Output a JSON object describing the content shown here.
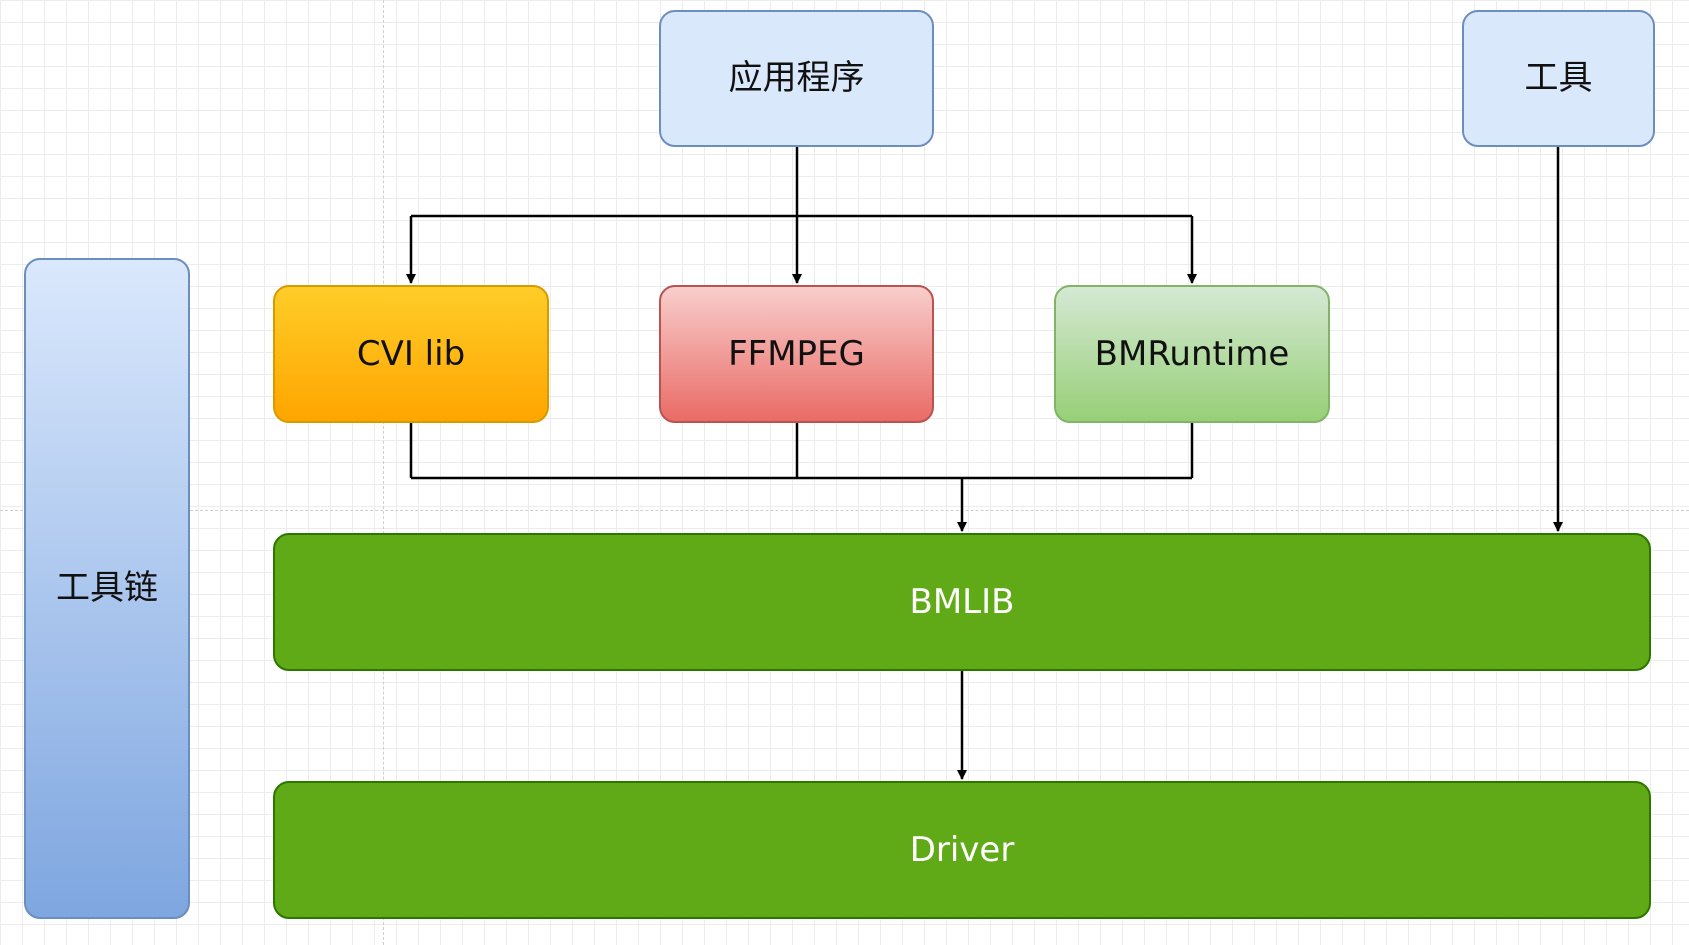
{
  "nodes": {
    "app": {
      "label": "应用程序"
    },
    "tools": {
      "label": "工具"
    },
    "toolchain": {
      "label": "工具链"
    },
    "cvi_lib": {
      "label": "CVI lib"
    },
    "ffmpeg": {
      "label": "FFMPEG"
    },
    "bmruntime": {
      "label": "BMRuntime"
    },
    "bmlib": {
      "label": "BMLIB"
    },
    "driver": {
      "label": "Driver"
    }
  },
  "colors": {
    "app_fill": "#dae8fc",
    "app_stroke": "#6c8ebf",
    "cvi_fill_top": "#ffcd28",
    "cvi_fill_bottom": "#ffa500",
    "ffmpeg_fill_top": "#f8cecc",
    "ffmpeg_fill_bottom": "#ea6b66",
    "bmruntime_fill_top": "#d5e8d4",
    "bmruntime_fill_bottom": "#97d077",
    "bmlib_fill": "#60a917",
    "driver_fill": "#60a917",
    "toolchain_fill_top": "#dae8fc",
    "toolchain_fill_bottom": "#7ea6e0",
    "connector": "#000000"
  },
  "edges": [
    {
      "from": "app",
      "to": "cvi_lib"
    },
    {
      "from": "app",
      "to": "ffmpeg"
    },
    {
      "from": "app",
      "to": "bmruntime"
    },
    {
      "from": "cvi_lib",
      "to": "bmlib"
    },
    {
      "from": "ffmpeg",
      "to": "bmlib"
    },
    {
      "from": "bmruntime",
      "to": "bmlib"
    },
    {
      "from": "tools",
      "to": "bmlib"
    },
    {
      "from": "bmlib",
      "to": "driver"
    }
  ]
}
